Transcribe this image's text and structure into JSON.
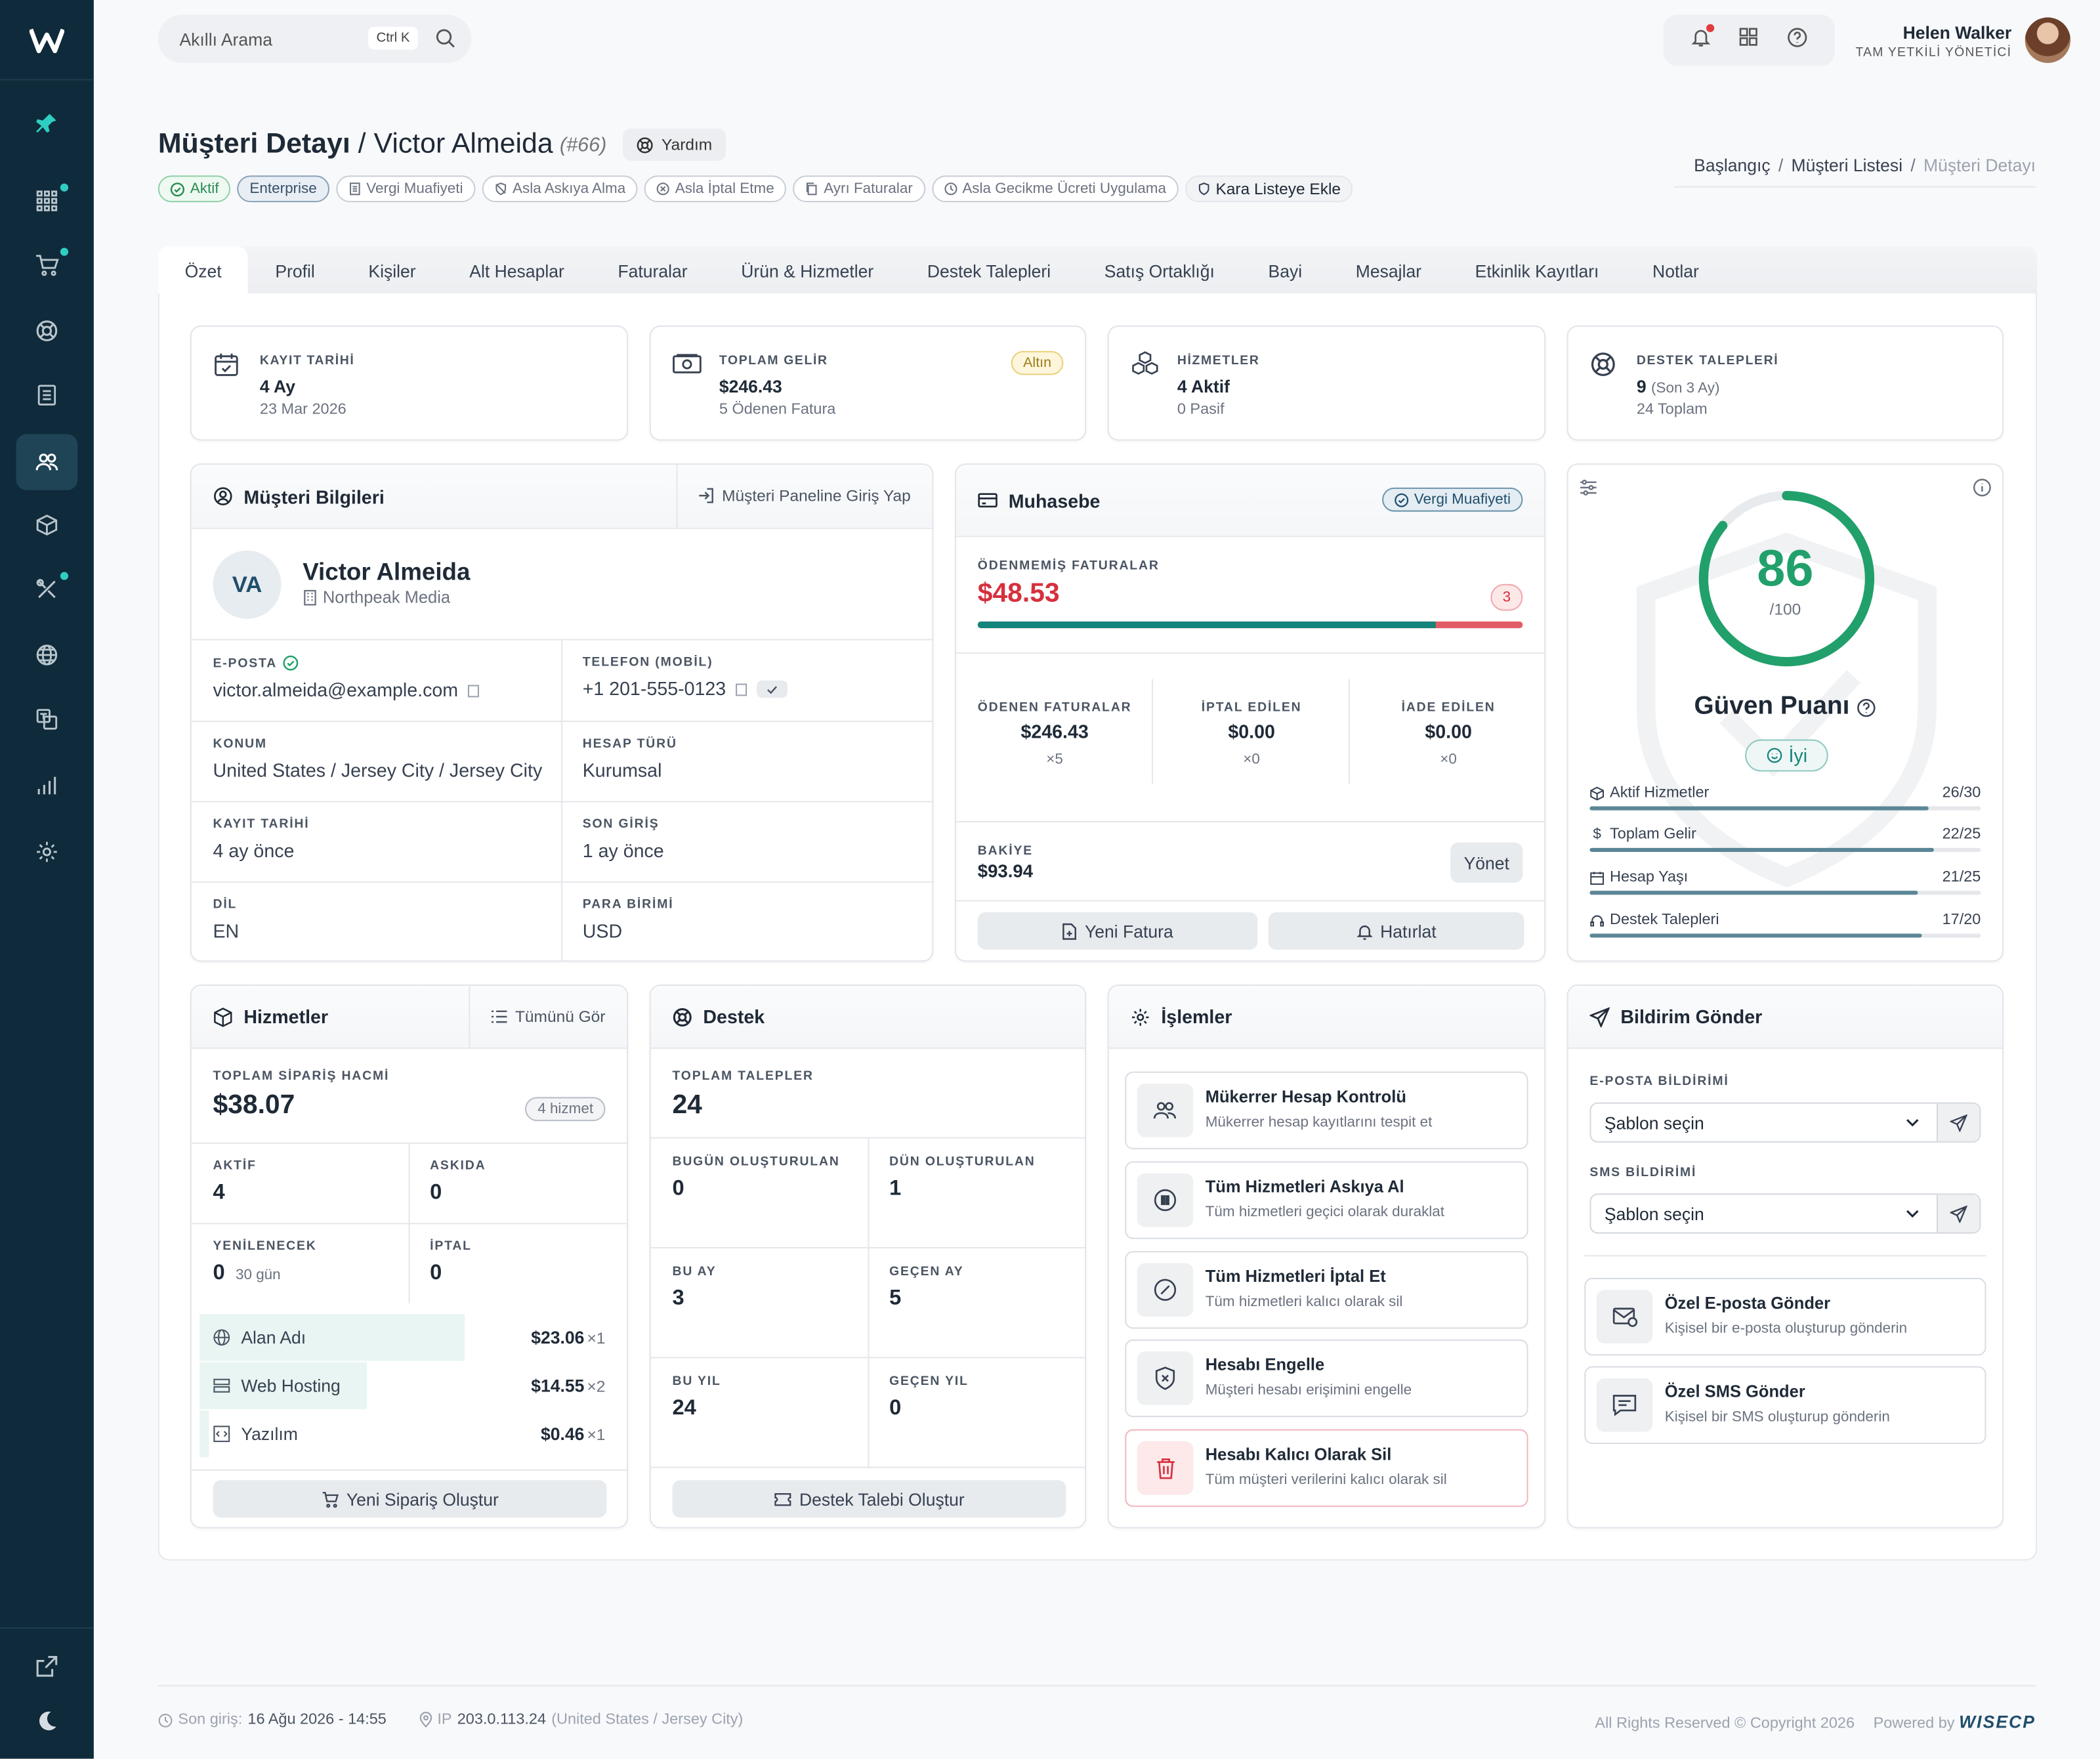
{
  "search": {
    "placeholder": "Akıllı Arama",
    "shortcut": "Ctrl K"
  },
  "user": {
    "name": "Helen Walker",
    "role": "TAM YETKİLİ YÖNETİCİ"
  },
  "page": {
    "title_bold": "Müşteri Detayı",
    "title_sep": " / ",
    "customer": "Victor Almeida",
    "id": "(#66)",
    "help": "Yardım"
  },
  "tags": [
    "Aktif",
    "Enterprise",
    "Vergi Muafiyeti",
    "Asla Askıya Alma",
    "Asla İptal Etme",
    "Ayrı Faturalar",
    "Asla Gecikme Ücreti Uygulama",
    "Kara Listeye Ekle"
  ],
  "breadcrumb": [
    "Başlangıç",
    "Müşteri Listesi",
    "Müşteri Detayı"
  ],
  "tabs": [
    "Özet",
    "Profil",
    "Kişiler",
    "Alt Hesaplar",
    "Faturalar",
    "Ürün & Hizmetler",
    "Destek Talepleri",
    "Satış Ortaklığı",
    "Bayi",
    "Mesajlar",
    "Etkinlik Kayıtları",
    "Notlar"
  ],
  "stats": [
    {
      "label": "KAYIT TARİHİ",
      "value": "4 Ay",
      "sub": "23 Mar 2026"
    },
    {
      "label": "TOPLAM GELİR",
      "value": "$246.43",
      "sub": "5 Ödenen Fatura",
      "badge": "Altın"
    },
    {
      "label": "HİZMETLER",
      "value": "4 Aktif",
      "sub": "0 Pasif"
    },
    {
      "label": "DESTEK TALEPLERİ",
      "value": "9",
      "value_extra": "(Son 3 Ay)",
      "sub": "24 Toplam"
    }
  ],
  "info": {
    "title": "Müşteri Bilgileri",
    "login_btn": "Müşteri Paneline Giriş Yap",
    "initials": "VA",
    "name": "Victor Almeida",
    "company": "Northpeak Media",
    "fields": [
      {
        "label": "E-POSTA",
        "value": "victor.almeida@example.com"
      },
      {
        "label": "TELEFON (MOBİL)",
        "value": "+1 201-555-0123"
      },
      {
        "label": "KONUM",
        "value": "United States / Jersey City / Jersey City"
      },
      {
        "label": "HESAP TÜRÜ",
        "value": "Kurumsal"
      },
      {
        "label": "KAYIT TARİHİ",
        "value": "4 ay önce"
      },
      {
        "label": "SON GİRİŞ",
        "value": "1 ay önce"
      },
      {
        "label": "DİL",
        "value": "EN"
      },
      {
        "label": "PARA BİRİMİ",
        "value": "USD"
      }
    ]
  },
  "accounting": {
    "title": "Muhasebe",
    "badge": "Vergi Muafiyeti",
    "unpaid_label": "ÖDENMEMİŞ FATURALAR",
    "unpaid_value": "$48.53",
    "unpaid_count": "3",
    "unpaid_ratio": 0.84,
    "cols": [
      {
        "label": "ÖDENEN FATURALAR",
        "value": "$246.43",
        "count": "×5"
      },
      {
        "label": "İPTAL EDİLEN",
        "value": "$0.00",
        "count": "×0"
      },
      {
        "label": "İADE EDİLEN",
        "value": "$0.00",
        "count": "×0"
      }
    ],
    "balance_label": "BAKİYE",
    "balance_value": "$93.94",
    "manage": "Yönet",
    "new_invoice": "Yeni Fatura",
    "remind": "Hatırlat"
  },
  "trust": {
    "score": "86",
    "max": "/100",
    "score_value": 86,
    "title": "Güven Puanı",
    "level": "İyi",
    "rows": [
      {
        "label": "Aktif Hizmetler",
        "value": "26/30",
        "ratio": 0.867
      },
      {
        "label": "Toplam Gelir",
        "value": "22/25",
        "ratio": 0.88
      },
      {
        "label": "Hesap Yaşı",
        "value": "21/25",
        "ratio": 0.84
      },
      {
        "label": "Destek Talepleri",
        "value": "17/20",
        "ratio": 0.85
      }
    ],
    "colors": {
      "ring": "#22a06b",
      "bar": "#5b8696"
    }
  },
  "services": {
    "title": "Hizmetler",
    "see_all": "Tümünü Gör",
    "total_label": "TOPLAM SİPARİŞ HACMİ",
    "total_value": "$38.07",
    "count_badge": "4 hizmet",
    "grid": [
      {
        "label": "AKTİF",
        "value": "4"
      },
      {
        "label": "ASKIDA",
        "value": "0"
      },
      {
        "label": "YENİLENECEK",
        "value": "0",
        "extra": "30 gün"
      },
      {
        "label": "İPTAL",
        "value": "0"
      }
    ],
    "items": [
      {
        "name": "Alan Adı",
        "price": "$23.06",
        "qty": "×1",
        "share": 0.6
      },
      {
        "name": "Web Hosting",
        "price": "$14.55",
        "qty": "×2",
        "share": 0.38
      },
      {
        "name": "Yazılım",
        "price": "$0.46",
        "qty": "×1",
        "share": 0.02
      }
    ],
    "new_order": "Yeni Sipariş Oluştur"
  },
  "support": {
    "title": "Destek",
    "total_label": "TOPLAM TALEPLER",
    "total_value": "24",
    "grid": [
      {
        "label": "BUGÜN OLUŞTURULAN",
        "value": "0"
      },
      {
        "label": "DÜN OLUŞTURULAN",
        "value": "1"
      },
      {
        "label": "BU AY",
        "value": "3"
      },
      {
        "label": "GEÇEN AY",
        "value": "5"
      },
      {
        "label": "BU YIL",
        "value": "24"
      },
      {
        "label": "GEÇEN YIL",
        "value": "0"
      }
    ],
    "create": "Destek Talebi Oluştur"
  },
  "actions": {
    "title": "İşlemler",
    "items": [
      {
        "title": "Mükerrer Hesap Kontrolü",
        "desc": "Mükerrer hesap kayıtlarını tespit et"
      },
      {
        "title": "Tüm Hizmetleri Askıya Al",
        "desc": "Tüm hizmetleri geçici olarak duraklat"
      },
      {
        "title": "Tüm Hizmetleri İptal Et",
        "desc": "Tüm hizmetleri kalıcı olarak sil"
      },
      {
        "title": "Hesabı Engelle",
        "desc": "Müşteri hesabı erişimini engelle"
      },
      {
        "title": "Hesabı Kalıcı Olarak Sil",
        "desc": "Tüm müşteri verilerini kalıcı olarak sil"
      }
    ]
  },
  "notify": {
    "title": "Bildirim Gönder",
    "email_label": "E-POSTA BİLDİRİMİ",
    "sms_label": "SMS BİLDİRİMİ",
    "select": "Şablon seçin",
    "custom": [
      {
        "title": "Özel E-posta Gönder",
        "desc": "Kişisel bir e-posta oluşturup gönderin"
      },
      {
        "title": "Özel SMS Gönder",
        "desc": "Kişisel bir SMS oluşturup gönderin"
      }
    ]
  },
  "footer": {
    "last_login_label": "Son giriş:",
    "last_login": "16 Ağu 2026 - 14:55",
    "ip_label": "IP",
    "ip": "203.0.113.24",
    "ip_loc": "(United States / Jersey City)",
    "rights": "All Rights Reserved © Copyright 2026",
    "powered": "Powered by",
    "brand": "WISECP"
  }
}
